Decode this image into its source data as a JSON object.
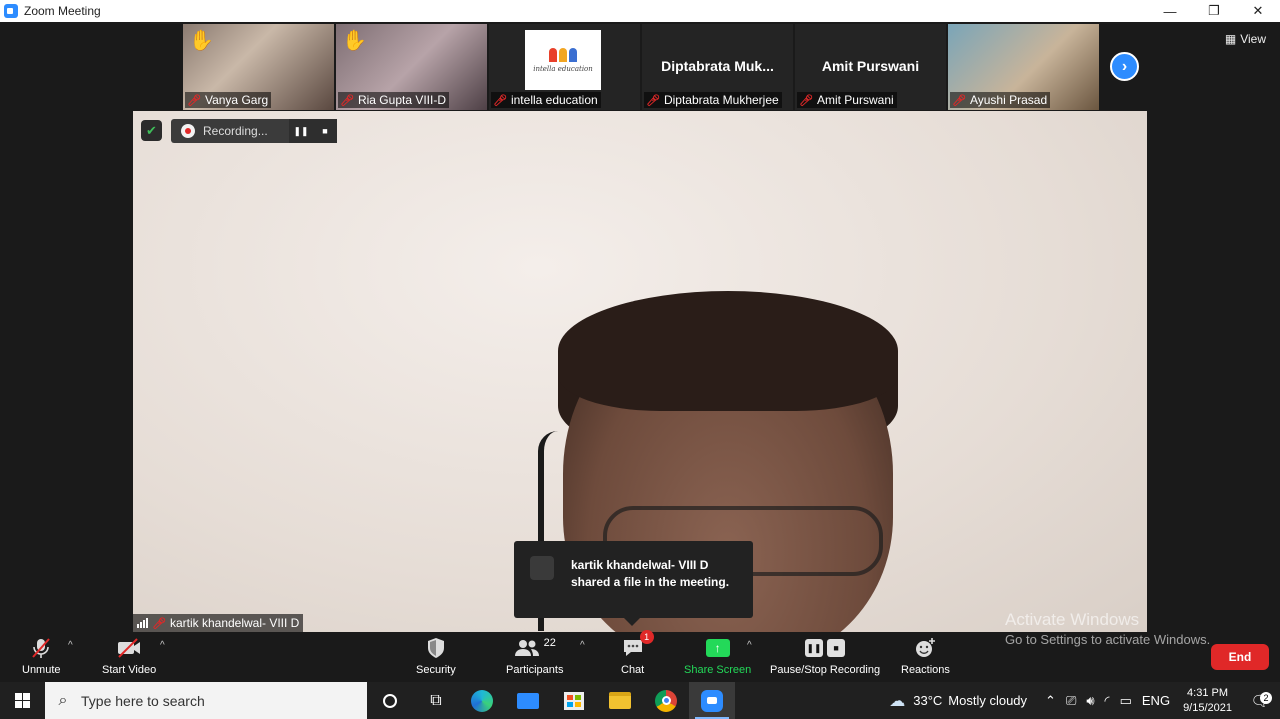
{
  "titlebar": {
    "title": "Zoom Meeting",
    "minimize": "—",
    "restore": "❐",
    "close": "✕"
  },
  "gallery": {
    "participants": [
      {
        "name": "Vanya Garg",
        "hand_raised": true,
        "muted": true
      },
      {
        "name": "Ria Gupta VIII-D",
        "hand_raised": true,
        "muted": true
      },
      {
        "name": "intella education",
        "logo_text": "intella education",
        "muted": true
      },
      {
        "name": "Diptabrata Mukherjee",
        "display_name": "Diptabrata  Muk...",
        "muted": true
      },
      {
        "name": "Amit Purswani",
        "display_name": "Amit Purswani",
        "muted": true
      },
      {
        "name": "Ayushi Prasad",
        "muted": true
      }
    ],
    "next_label": "›",
    "view_label": "View"
  },
  "recording": {
    "status": "Recording...",
    "pause_icon": "❚❚",
    "stop_icon": "■"
  },
  "speaker": {
    "name": "kartik khandelwal- VIII D"
  },
  "toast": {
    "line1": "kartik khandelwal- VIII D",
    "line2": "shared a file in the meeting."
  },
  "toolbar": {
    "unmute": "Unmute",
    "start_video": "Start Video",
    "security": "Security",
    "participants": "Participants",
    "participants_count": "22",
    "chat": "Chat",
    "chat_badge": "1",
    "share_screen": "Share Screen",
    "pause_stop_recording": "Pause/Stop Recording",
    "reactions": "Reactions",
    "end": "End"
  },
  "watermark": {
    "line1": "Activate Windows",
    "line2": "Go to Settings to activate Windows."
  },
  "taskbar": {
    "search_placeholder": "Type here to search",
    "weather_temp": "33°C",
    "weather_text": "Mostly cloudy",
    "language": "ENG",
    "time": "4:31 PM",
    "date": "9/15/2021",
    "notification_count": "2"
  },
  "colors": {
    "zoom_blue": "#2d8cff",
    "share_green": "#23d959",
    "end_red": "#e02828"
  }
}
